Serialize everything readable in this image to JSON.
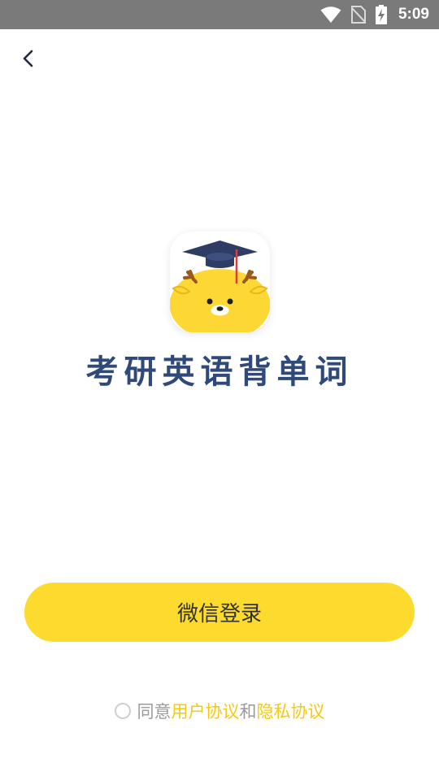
{
  "status_bar": {
    "time": "5:09",
    "icons": [
      "wifi-icon",
      "no-sim-icon",
      "battery-charging-icon"
    ]
  },
  "nav": {
    "back_icon": "chevron-left-icon"
  },
  "app": {
    "title": "考研英语背单词",
    "logo_icon": "deer-graduation-cap-logo"
  },
  "login": {
    "wechat_label": "微信登录"
  },
  "agreement": {
    "prefix": "同意",
    "user_agreement": "用户协议",
    "conjunction": "和",
    "privacy_agreement": "隐私协议"
  },
  "colors": {
    "title": "#2f4a7a",
    "button": "#fddb2e",
    "link": "#f5c90f",
    "status_bar": "#7a7a7a"
  }
}
